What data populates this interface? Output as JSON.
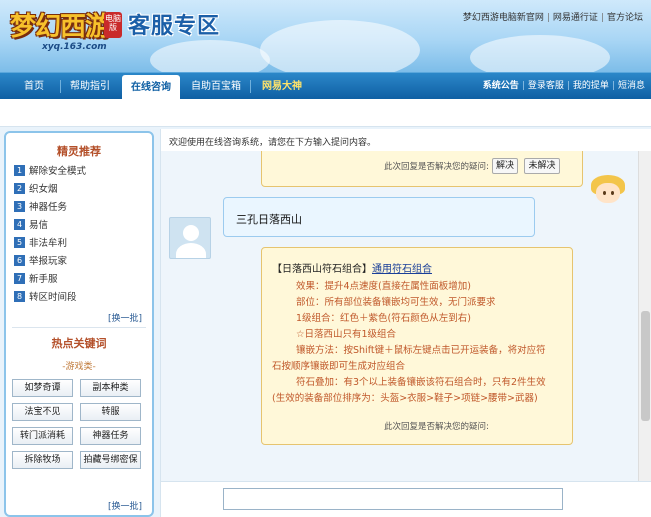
{
  "header": {
    "logo_text": "梦幻西游",
    "logo_badge": "电脑版",
    "logo_domain": "xyq.163.com",
    "zone_title": "客服专区",
    "top_links": [
      "梦幻西游电脑新官网",
      "网易通行证",
      "官方论坛"
    ]
  },
  "nav": {
    "tabs": [
      {
        "label": "首页"
      },
      {
        "label": "帮助指引"
      },
      {
        "label": "在线咨询"
      },
      {
        "label": "自助百宝箱"
      },
      {
        "label": "网易大神"
      }
    ],
    "right_links": [
      "系统公告",
      "登录客服",
      "我的提单",
      "短消息"
    ]
  },
  "sidebar": {
    "title": "精灵推荐",
    "items": [
      {
        "num": "1",
        "label": "解除安全模式"
      },
      {
        "num": "2",
        "label": "织女烟"
      },
      {
        "num": "3",
        "label": "神器任务"
      },
      {
        "num": "4",
        "label": "易信"
      },
      {
        "num": "5",
        "label": "非法牟利"
      },
      {
        "num": "6",
        "label": "举报玩家"
      },
      {
        "num": "7",
        "label": "新手服"
      },
      {
        "num": "8",
        "label": "转区时间段"
      }
    ],
    "more_label": "[换一批]",
    "keywords_title": "热点关键词",
    "keywords_sub": "-游戏类-",
    "keywords": [
      "如梦奇谭",
      "副本种类",
      "法宝不见",
      "转服",
      "转门派消耗",
      "神器任务",
      "拆除牧场",
      "拍藏号绑密保"
    ],
    "more_label_2": "[换一批]"
  },
  "main": {
    "welcome": "欢迎使用在线咨询系统，请您在下方输入提问内容。",
    "feedback_question": "此次回复是否解决您的疑问:",
    "resolved_label": "解决",
    "unresolved_label": "未解决",
    "user_message": "三孔日落西山",
    "answer": {
      "title": "【日落西山符石组合】",
      "title_link": "通用符石组合",
      "lines": [
        "效果：提升4点速度(直接在属性面板增加)",
        "部位：所有部位装备镶嵌均可生效，无门派要求",
        "1级组合：红色＋紫色(符石颜色从左到右)",
        "☆日落西山只有1级组合",
        "镶嵌方法：按Shift键＋鼠标左键点击已开运装备，将对应符",
        "石按顺序镶嵌即可生成对应组合",
        "符石叠加：有3个以上装备镶嵌该符石组合时，只有2件生效",
        "(生效的装备部位排序为：头盔>衣服>鞋子>项链>腰带>武器)"
      ]
    },
    "input_value": ""
  }
}
